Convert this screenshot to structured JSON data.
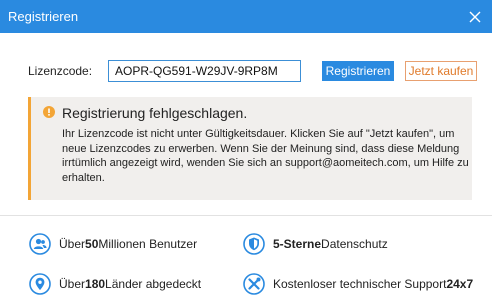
{
  "window": {
    "title": "Registrieren"
  },
  "form": {
    "label": "Lizenzcode:",
    "code_value": "AOPR-QG591-W29JV-9RP8M",
    "register_label": "Registrieren",
    "buy_label": "Jetzt kaufen"
  },
  "error": {
    "heading": "Registrierung fehlgeschlagen.",
    "message": "Ihr Lizenzcode ist nicht unter Gültigkeitsdauer. Klicken Sie auf \"Jetzt kaufen\", um neue Lizenzcodes zu erwerben. Wenn Sie der Meinung sind, dass diese Meldung irrtümlich angezeigt wird, wenden Sie sich an support@aomeitech.com, um Hilfe zu erhalten."
  },
  "features": [
    {
      "prefix": "Über ",
      "bold": "50",
      "suffix": " Millionen Benutzer",
      "icon": "users-icon"
    },
    {
      "prefix": "",
      "bold": "5-Sterne",
      "suffix": " Datenschutz",
      "icon": "shield-icon"
    },
    {
      "prefix": "Über ",
      "bold": "180",
      "suffix": " Länder abgedeckt",
      "icon": "location-pin-icon"
    },
    {
      "prefix": "Kostenloser technischer Support ",
      "bold": "24x7",
      "suffix": "",
      "icon": "tools-icon"
    }
  ],
  "colors": {
    "accent": "#2a8ae0",
    "buy": "#e07a2a",
    "warning": "#f3a536",
    "error_bg": "#f1efed"
  }
}
